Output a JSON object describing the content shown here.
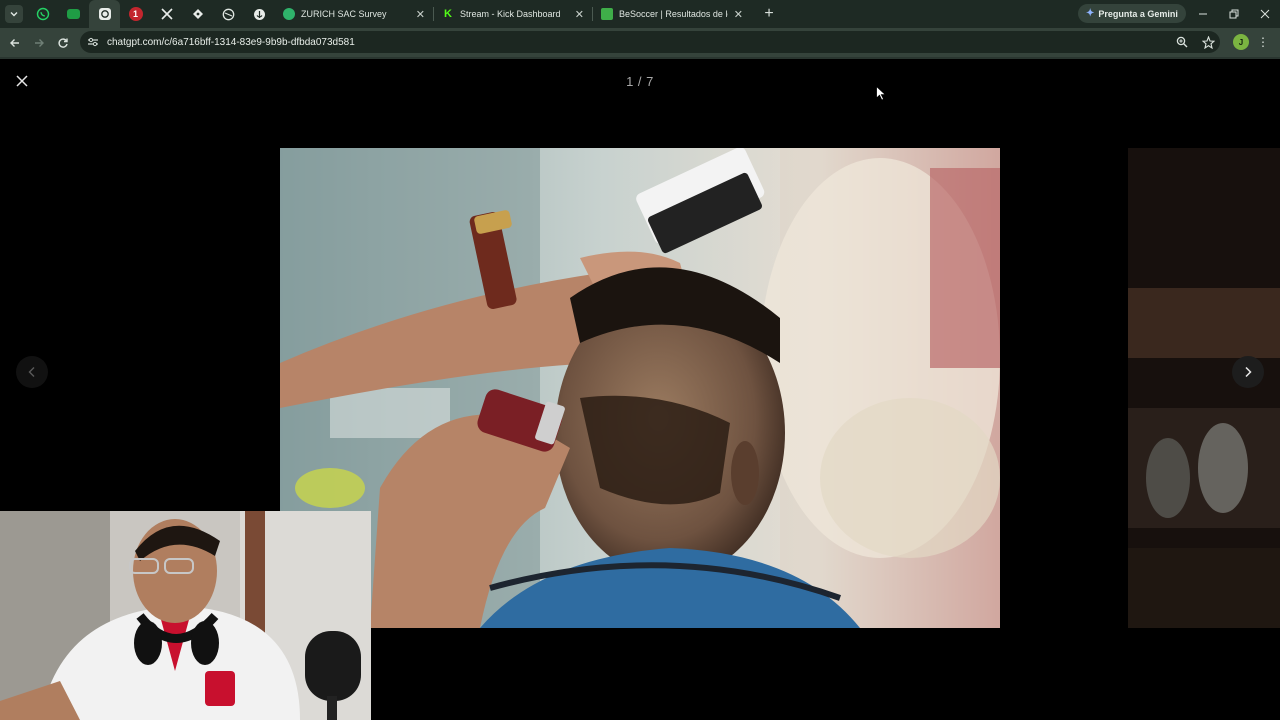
{
  "browser": {
    "tabs": [
      {
        "title": "ZURICH SAC Survey",
        "favicon": "surveymonkey-icon",
        "color": "#2fb36b"
      },
      {
        "title": "Stream - Kick Dashboard",
        "favicon": "kick-icon",
        "color": "#53fc18"
      },
      {
        "title": "BeSoccer | Resultados de los pa",
        "favicon": "besoccer-icon",
        "color": "#3fae49"
      }
    ],
    "gemini_button": "Pregunta a Gemini",
    "url": "chatgpt.com/c/6a716bff-1314-83e9-9b9b-dfbda073d581",
    "profile_initial": "J"
  },
  "viewer": {
    "counter": "1 / 7"
  }
}
